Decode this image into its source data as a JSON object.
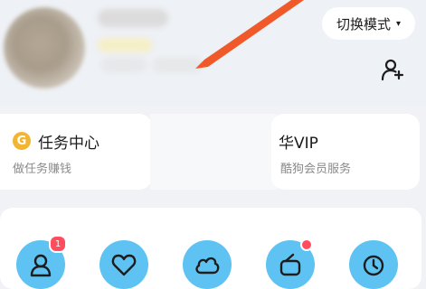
{
  "header": {
    "switch_mode_label": "切换模式",
    "caret_glyph": "▾",
    "add_friend_icon": "person-plus-icon"
  },
  "cards": {
    "task": {
      "coin_glyph": "G",
      "title": "任务中心",
      "subtitle": "做任务赚钱"
    },
    "vip": {
      "title": "华VIP",
      "subtitle": "酷狗会员服务"
    }
  },
  "features": {
    "items": [
      {
        "icon": "person-icon",
        "badge": "1"
      },
      {
        "icon": "heart-icon",
        "badge": ""
      },
      {
        "icon": "cloud-icon",
        "badge": ""
      },
      {
        "icon": "radio-icon",
        "badge": ""
      },
      {
        "icon": "clock-icon",
        "badge": ""
      }
    ]
  },
  "colors": {
    "accent_blue": "#5ec3f2",
    "badge_red": "#ff4d5e",
    "arrow_orange": "#f05a2a",
    "coin_gold": "#f2b531"
  }
}
